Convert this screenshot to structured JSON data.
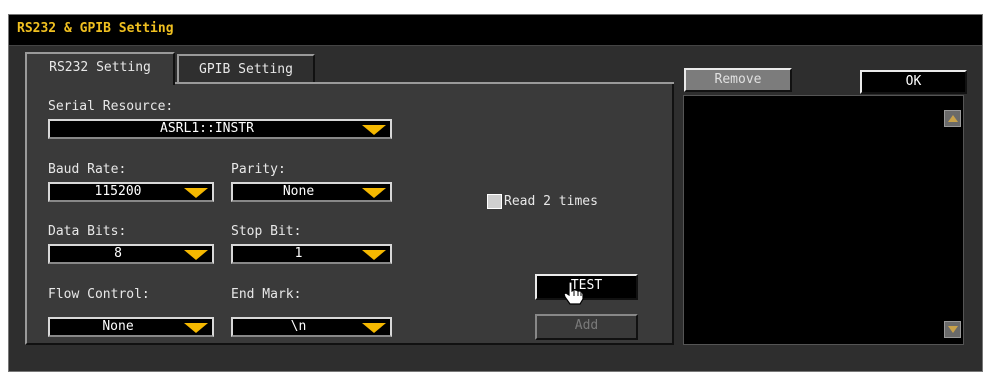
{
  "window": {
    "title": "RS232 & GPIB Setting"
  },
  "tabs": [
    {
      "label": "RS232 Setting",
      "active": true
    },
    {
      "label": "GPIB Setting",
      "active": false
    }
  ],
  "rs232": {
    "serial_resource": {
      "label": "Serial Resource:",
      "value": "ASRL1::INSTR"
    },
    "baud_rate": {
      "label": "Baud Rate:",
      "value": "115200"
    },
    "parity": {
      "label": "Parity:",
      "value": "None"
    },
    "data_bits": {
      "label": "Data Bits:",
      "value": "8"
    },
    "stop_bit": {
      "label": "Stop Bit:",
      "value": "1"
    },
    "flow_control": {
      "label": "Flow Control:",
      "value": "None"
    },
    "end_mark": {
      "label": "End Mark:",
      "value": "\\n"
    }
  },
  "read_twice": {
    "label": "Read 2 times",
    "checked": false
  },
  "buttons": {
    "test": "TEST",
    "add": "Add",
    "remove": "Remove",
    "ok": "OK"
  },
  "colors": {
    "title_accent": "#f0c020",
    "dropdown_arrow": "#f5b800",
    "dialog_bg": "#3a3a3a"
  },
  "icons": {
    "dropdown": "chevron-down-icon",
    "cursor": "hand-pointer-icon",
    "scroll_up": "scroll-up-icon",
    "scroll_down": "scroll-down-icon"
  }
}
